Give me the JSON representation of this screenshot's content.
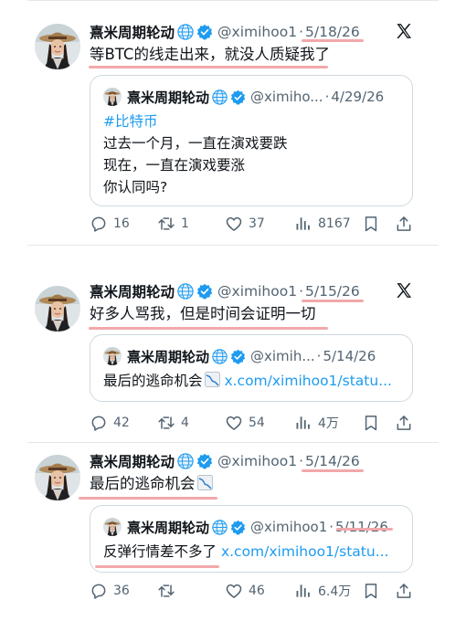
{
  "tweets": [
    {
      "name": "熹米周期轮动",
      "handle": "@ximihoo1",
      "date": "5/18/26",
      "text": "等BTC的线走出来，就没人质疑我了",
      "quote": {
        "name": "熹米周期轮动",
        "handle": "@ximiho...",
        "date": "4/29/26",
        "hashtag": "#比特币",
        "lines": [
          "过去一个月，一直在演戏要跌",
          "现在，一直在演戏要涨",
          "你认同吗?"
        ]
      },
      "stats": {
        "replies": "16",
        "retweets": "1",
        "likes": "37",
        "views": "8167"
      }
    },
    {
      "name": "熹米周期轮动",
      "handle": "@ximihoo1",
      "date": "5/15/26",
      "text": "好多人骂我，但是时间会证明一切",
      "quote": {
        "name": "熹米周期轮动",
        "handle": "@ximih...",
        "date": "5/14/26",
        "text": "最后的逃命机会",
        "link": "x.com/ximihoo1/statu..."
      },
      "stats": {
        "replies": "42",
        "retweets": "4",
        "likes": "54",
        "views": "4万"
      }
    },
    {
      "name": "熹米周期轮动",
      "handle": "@ximihoo1",
      "date": "5/14/26",
      "text": "最后的逃命机会",
      "quote": {
        "name": "熹米周期轮动",
        "handle": "@ximihoo1",
        "date": "5/11/26",
        "text": "反弹行情差不多了",
        "link": "x.com/ximihoo1/statu..."
      },
      "stats": {
        "replies": "36",
        "retweets": "",
        "likes": "46",
        "views": "6.4万"
      }
    }
  ],
  "colors": {
    "accent": "#1d9bf0",
    "verified": "#1d9bf0",
    "secondary": "#536471",
    "highlight": "#f2a8ab",
    "border": "#cfd9de"
  },
  "icons": [
    "globe-icon",
    "verified-badge-icon",
    "x-logo-icon",
    "reply-icon",
    "retweet-icon",
    "like-icon",
    "views-icon",
    "bookmark-icon",
    "share-icon",
    "chart-decreasing-emoji"
  ]
}
